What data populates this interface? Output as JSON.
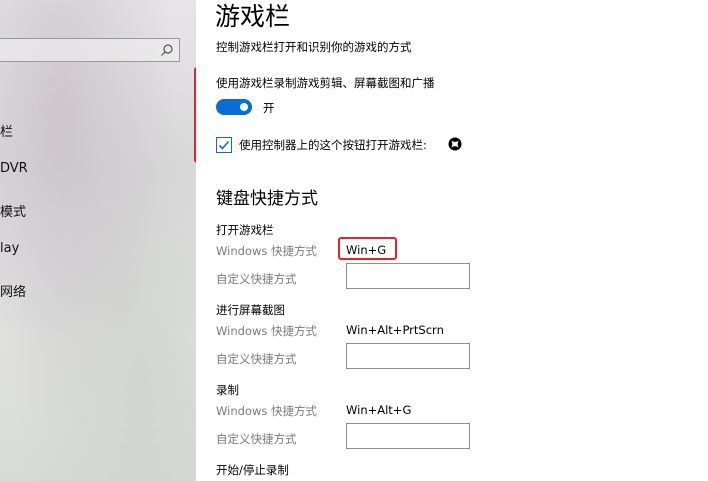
{
  "sidebar": {
    "search": {
      "placeholder": "",
      "value": ""
    },
    "items": [
      {
        "label": "栏"
      },
      {
        "label": "DVR"
      },
      {
        "label": "模式"
      },
      {
        "label": "lay"
      },
      {
        "label": "网络"
      }
    ]
  },
  "page": {
    "title": "游戏栏",
    "subtitle": "控制游戏栏打开和识别你的游戏的方式"
  },
  "game_bar": {
    "record_label": "使用游戏栏录制游戏剪辑、屏幕截图和广播",
    "toggle_state_label": "开",
    "toggle_on": true,
    "controller_checkbox_label": "使用控制器上的这个按钮打开游戏栏:",
    "controller_checkbox_checked": true,
    "controller_icon": "xbox-icon"
  },
  "shortcuts": {
    "section_title": "键盘快捷方式",
    "windows_label": "Windows 快捷方式",
    "custom_label": "自定义快捷方式",
    "groups": [
      {
        "title": "打开游戏栏",
        "windows_shortcut": "Win+G",
        "custom_value": ""
      },
      {
        "title": "进行屏幕截图",
        "windows_shortcut": "Win+Alt+PrtScrn",
        "custom_value": ""
      },
      {
        "title": "录制",
        "windows_shortcut": "Win+Alt+G",
        "custom_value": ""
      },
      {
        "title": "开始/停止录制"
      }
    ]
  },
  "colors": {
    "accent": "#0a6cd4",
    "highlight_border": "#e3242b",
    "secondary_text": "#7a7a7a"
  }
}
